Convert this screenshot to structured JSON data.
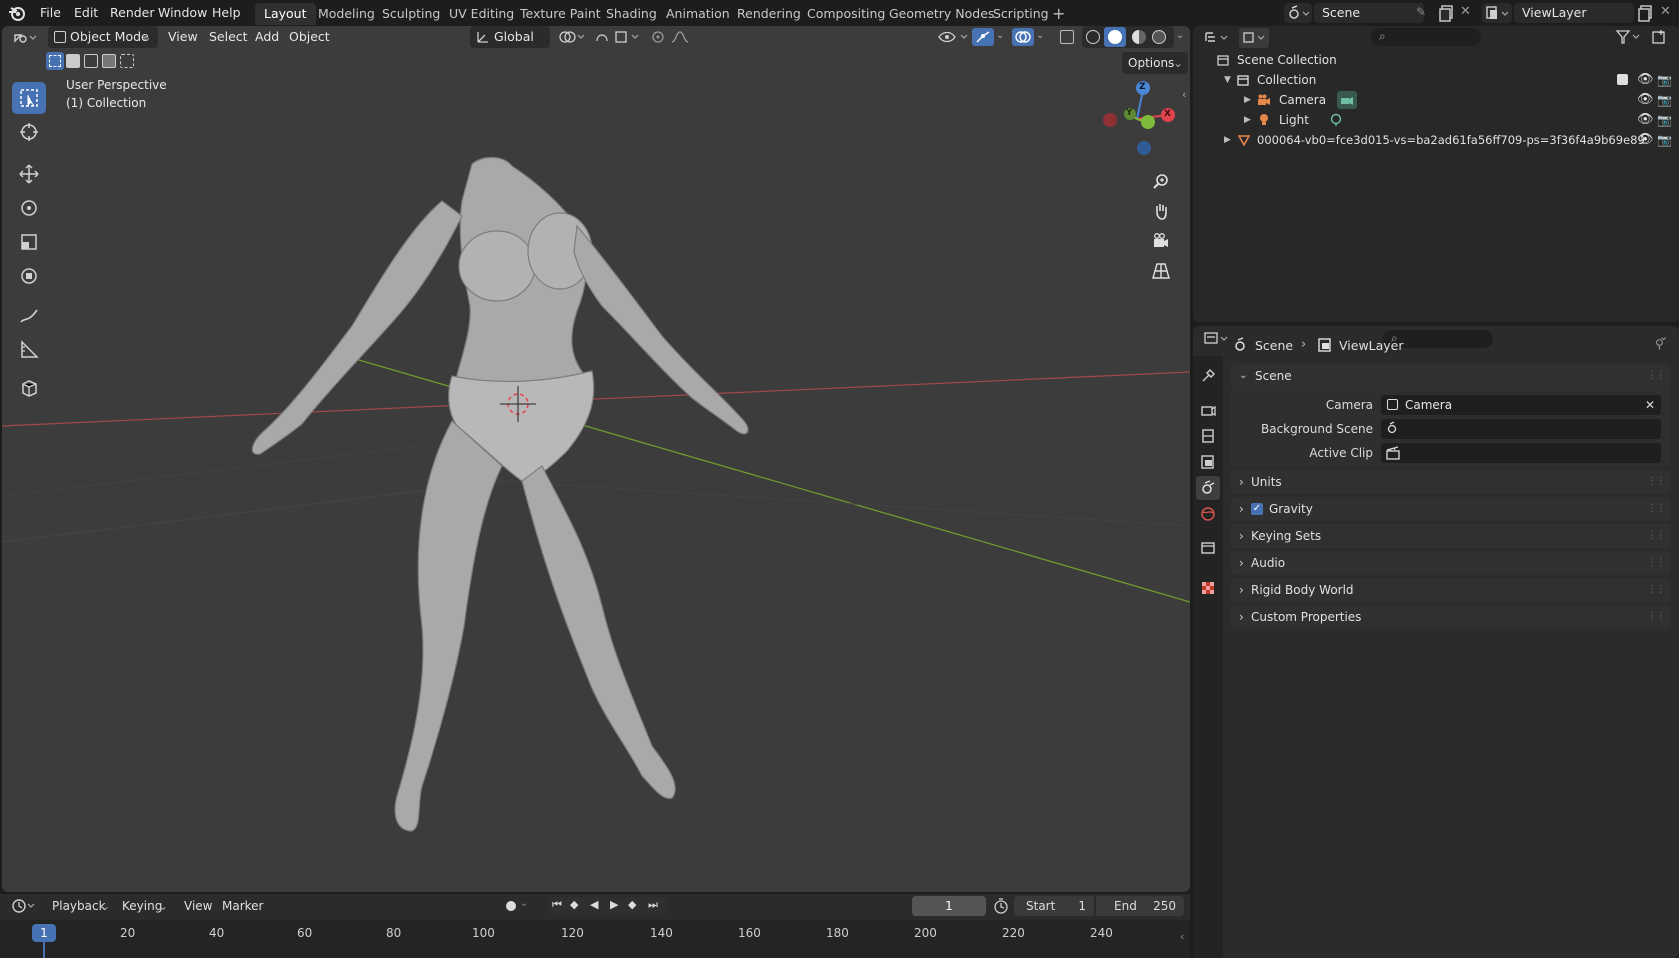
{
  "menubar": {
    "items": [
      "File",
      "Edit",
      "Render",
      "Window",
      "Help"
    ]
  },
  "workspaces": [
    "Layout",
    "Modeling",
    "Sculpting",
    "UV Editing",
    "Texture Paint",
    "Shading",
    "Animation",
    "Rendering",
    "Compositing",
    "Geometry Nodes",
    "Scripting"
  ],
  "active_workspace": "Layout",
  "scene": {
    "name": "Scene",
    "view_layer": "ViewLayer"
  },
  "viewport_header": {
    "mode": "Object Mode",
    "menus": [
      "View",
      "Select",
      "Add",
      "Object"
    ],
    "orientation": "Global",
    "options_label": "Options"
  },
  "viewport_overlay": {
    "perspective": "User Perspective",
    "collection": "(1) Collection"
  },
  "gizmo_axes": {
    "x": "X",
    "y": "Y",
    "z": "Z"
  },
  "outliner": {
    "root": "Scene Collection",
    "collection": "Collection",
    "items": [
      {
        "name": "Camera",
        "icon": "camera-icon"
      },
      {
        "name": "Light",
        "icon": "light-icon"
      }
    ],
    "mesh_object": "000064-vb0=fce3d015-vs=ba2ad61fa56ff709-ps=3f36f4a9b69e89"
  },
  "properties": {
    "breadcrumb": [
      "Scene",
      "ViewLayer"
    ],
    "scene_panel": {
      "title": "Scene",
      "camera_label": "Camera",
      "camera_value": "Camera",
      "background_scene_label": "Background Scene",
      "background_scene_value": "",
      "active_clip_label": "Active Clip",
      "active_clip_value": ""
    },
    "panels": [
      "Units",
      "Gravity",
      "Keying Sets",
      "Audio",
      "Rigid Body World",
      "Custom Properties"
    ],
    "gravity_enabled": true
  },
  "timeline": {
    "menus": [
      "Playback",
      "Keying",
      "View",
      "Marker"
    ],
    "current_frame": "1",
    "start_label": "Start",
    "start_value": "1",
    "end_label": "End",
    "end_value": "250",
    "ticks": [
      "1",
      "20",
      "40",
      "60",
      "80",
      "100",
      "120",
      "140",
      "160",
      "180",
      "200",
      "220",
      "240"
    ]
  },
  "colors": {
    "accent": "#4772b3",
    "axis_x": "#e3434b",
    "axis_y": "#7fbc3b",
    "axis_z": "#4a86d6",
    "viewport_bg": "#3c3c3c"
  }
}
